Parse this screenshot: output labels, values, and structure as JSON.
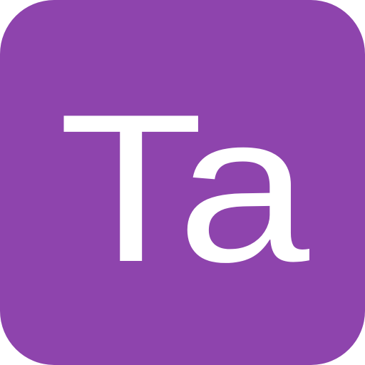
{
  "icon": {
    "symbol": "Ta",
    "background_color": "#8e44ad",
    "text_color": "#ffffff"
  }
}
